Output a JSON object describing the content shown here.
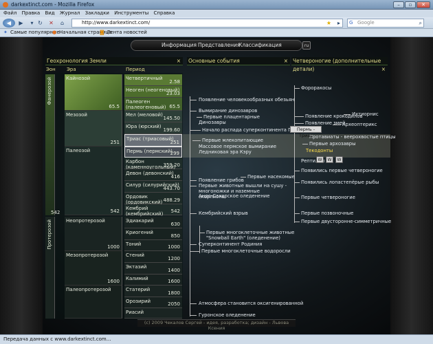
{
  "window": {
    "title": "darkextinct.com - Mozilla Firefox"
  },
  "menu": [
    "Файл",
    "Правка",
    "Вид",
    "Журнал",
    "Закладки",
    "Инструменты",
    "Справка"
  ],
  "address": {
    "url": "http://www.darkextinct.com/"
  },
  "search": {
    "placeholder": "Google"
  },
  "bookmarks": [
    "Самые популярные",
    "Начальная страница",
    "Лента новостей"
  ],
  "site_nav": [
    "Информация",
    "Представления",
    "Классификация"
  ],
  "panels": {
    "geo": "Геохронология Земли",
    "events": "Основные события",
    "tetrapods": "Четвероногие (дополнительные детали)"
  },
  "columns": {
    "eon": "Эон",
    "era": "Эра",
    "period": "Период"
  },
  "eons": [
    "Фанерозой",
    "Протерозой"
  ],
  "eon_value": "542",
  "eras": [
    {
      "name": "Кайнозой",
      "value": "65.5"
    },
    {
      "name": "Мезозой",
      "value": "251"
    },
    {
      "name": "Палеозой",
      "value": "542"
    },
    {
      "name": "Неопротерозой",
      "value": "1000"
    },
    {
      "name": "Мезопротерозой",
      "value": "1600"
    },
    {
      "name": "Палеопротерозой",
      "value": ""
    }
  ],
  "periods": [
    {
      "name": "Четвертичный",
      "value": "2.58"
    },
    {
      "name": "Неоген (неогеновый)",
      "value": "23.03"
    },
    {
      "name": "Палеоген (палеогеновый)",
      "value": "65.5"
    },
    {
      "name": "Мел (меловой)",
      "value": "145.50"
    },
    {
      "name": "Юра (юрский)",
      "value": "199.60"
    },
    {
      "name": "Триас (триасовый)",
      "value": "251"
    },
    {
      "name": "Пермь (пермский)",
      "value": "299"
    },
    {
      "name": "Карбон (каменноугольный)",
      "value": "359.20"
    },
    {
      "name": "Девон (девонский)",
      "value": "416"
    },
    {
      "name": "Силур (силурийский)",
      "value": "443.70"
    },
    {
      "name": "Ордовик (ордовикский)",
      "value": "488.29"
    },
    {
      "name": "Кембрий (кембрийский)",
      "value": "542"
    },
    {
      "name": "Эдиакарий",
      "value": "630"
    },
    {
      "name": "Криогений",
      "value": "850"
    },
    {
      "name": "Тоний",
      "value": "1000"
    },
    {
      "name": "Стений",
      "value": "1200"
    },
    {
      "name": "Эктазий",
      "value": "1400"
    },
    {
      "name": "Калимий",
      "value": "1600"
    },
    {
      "name": "Статерий",
      "value": "1800"
    },
    {
      "name": "Орозирий",
      "value": "2050"
    },
    {
      "name": "Риасий",
      "value": ""
    }
  ],
  "events": [
    "Появление человекообразных обезьян",
    "Вымирание динозавров",
    "Первые плацентарные",
    "Динозавры",
    "Начало распада суперконтинента Пангея",
    "Первые млекопитающие",
    "Массовое пермское вымирание",
    "Ледниковая эра Кэру",
    "Первые насекомые",
    "Появление грибов",
    "Первые животные вышли на сушу - многоножки и наземные скорпионы",
    "Андо-Сахарское оледенение",
    "Кембрийский взрыв",
    "Первые многоклеточные животные",
    "\"Snowball Earth\" (оледенение)",
    "Суперконтинент Родиния",
    "Первые многоклеточные водоросли",
    "Атмосфера становится оксигенированной",
    "Гуронское оледенение"
  ],
  "tetrapods": [
    "Фороракосы",
    "Ихтиорнис",
    "Появление крокодилов",
    "Появление змей",
    "Археоптерикс",
    "Протавиаты - веерохвостые птицы",
    "Первые архозавры",
    "Текодонты",
    "Рептилии",
    "Появились первые четвероногие",
    "Появились лопастепёрые рыбы",
    "Первые четвероногие",
    "Первые позвоночные",
    "Первые двусторонне-симметричные"
  ],
  "tooltip": "Пермь - Триас",
  "tooltip_buttons": [
    "W",
    "W",
    "W"
  ],
  "footer": "(c) 2009 Чекалов Сергей - идея, разработка; дизайн - Львова Ксения",
  "status": "Передача данных с www.darkextinct.com...",
  "colors": {
    "panel_text": "#e2dc8a",
    "highlight": "#c8c3a0",
    "cenozoic": "#6a8f3a"
  }
}
